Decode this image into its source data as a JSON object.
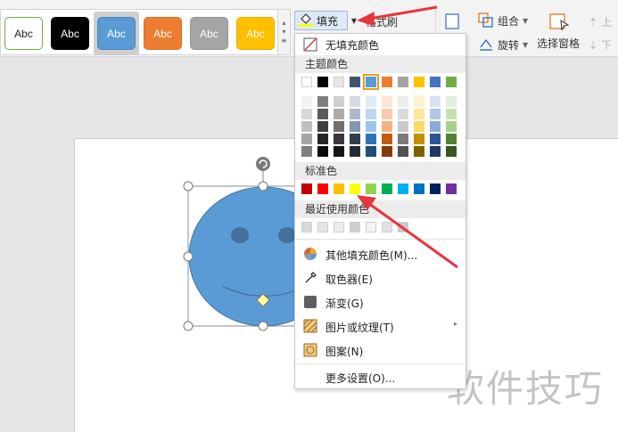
{
  "ribbon": {
    "swatch_text": "Abc",
    "swatches": [
      {
        "bg": "#ffffff",
        "border": "#70ad47",
        "color": "#222222"
      },
      {
        "bg": "#000000",
        "border": "#000000",
        "color": "#ffffff"
      },
      {
        "bg": "#5b9bd5",
        "border": "#4a86bd",
        "color": "#ffffff"
      },
      {
        "bg": "#ed7d31",
        "border": "#d96f28",
        "color": "#ffffff"
      },
      {
        "bg": "#a5a5a5",
        "border": "#939393",
        "color": "#ffffff"
      },
      {
        "bg": "#ffc000",
        "border": "#e6ad00",
        "color": "#ffffff"
      }
    ],
    "fill_label": "填充",
    "format_brush_label": "格式刷",
    "group_label": "组合",
    "rotate_label": "旋转",
    "selection_pane_label": "选择窗格",
    "up_label": "上",
    "down_label": "下"
  },
  "menu": {
    "no_fill": "无填充颜色",
    "theme_colors_header": "主题颜色",
    "standard_colors_header": "标准色",
    "recent_colors_header": "最近使用颜色",
    "more_fill_colors": "其他填充颜色(M)...",
    "eyedropper": "取色器(E)",
    "gradient": "渐变(G)",
    "picture_or_texture": "图片或纹理(T)",
    "pattern": "图案(N)",
    "more_settings": "更多设置(O)...",
    "theme_top_row": [
      "#ffffff",
      "#000000",
      "#e7e6e6",
      "#44546a",
      "#5b9bd5",
      "#ed7d31",
      "#a5a5a5",
      "#ffc000",
      "#4472c4",
      "#70ad47"
    ],
    "theme_shades": [
      [
        "#f2f2f2",
        "#7f7f7f",
        "#d0cece",
        "#d6dce4",
        "#deebf6",
        "#fbe5d5",
        "#ededed",
        "#fff2cc",
        "#d9e2f3",
        "#e2efd9"
      ],
      [
        "#d8d8d8",
        "#595959",
        "#aeabab",
        "#adb9ca",
        "#bdd7ee",
        "#f7cbac",
        "#dbdbdb",
        "#fee599",
        "#b4c6e7",
        "#c5e0b3"
      ],
      [
        "#bfbfbf",
        "#3f3f3f",
        "#757070",
        "#8496b0",
        "#9dc3e6",
        "#f4b183",
        "#c9c9c9",
        "#ffd965",
        "#8eaadb",
        "#a8d08d"
      ],
      [
        "#a5a5a5",
        "#262626",
        "#3a3838",
        "#323f4f",
        "#2e75b5",
        "#c55a11",
        "#7b7b7b",
        "#bf9000",
        "#2f5496",
        "#538135"
      ],
      [
        "#7f7f7f",
        "#0c0c0c",
        "#171616",
        "#222a35",
        "#1e4e79",
        "#833c0b",
        "#525252",
        "#7f6000",
        "#1f3864",
        "#375623"
      ]
    ],
    "standard_colors": [
      "#c00000",
      "#ff0000",
      "#ffc000",
      "#ffff00",
      "#92d050",
      "#00b050",
      "#00b0f0",
      "#0070c0",
      "#002060",
      "#7030a0"
    ],
    "recent_colors": [
      "#d9d9d9",
      "#e6e6e6",
      "#ededed",
      "#d0d0d0",
      "#f5f5f5",
      "#e2e2e2",
      "#c8c8c8"
    ]
  },
  "shape": {
    "fill_color": "#5b9bd5",
    "stroke_color": "#41719c",
    "eye_color": "#41719c"
  },
  "watermark": "软件技巧",
  "annotation_color": "#e8343c"
}
